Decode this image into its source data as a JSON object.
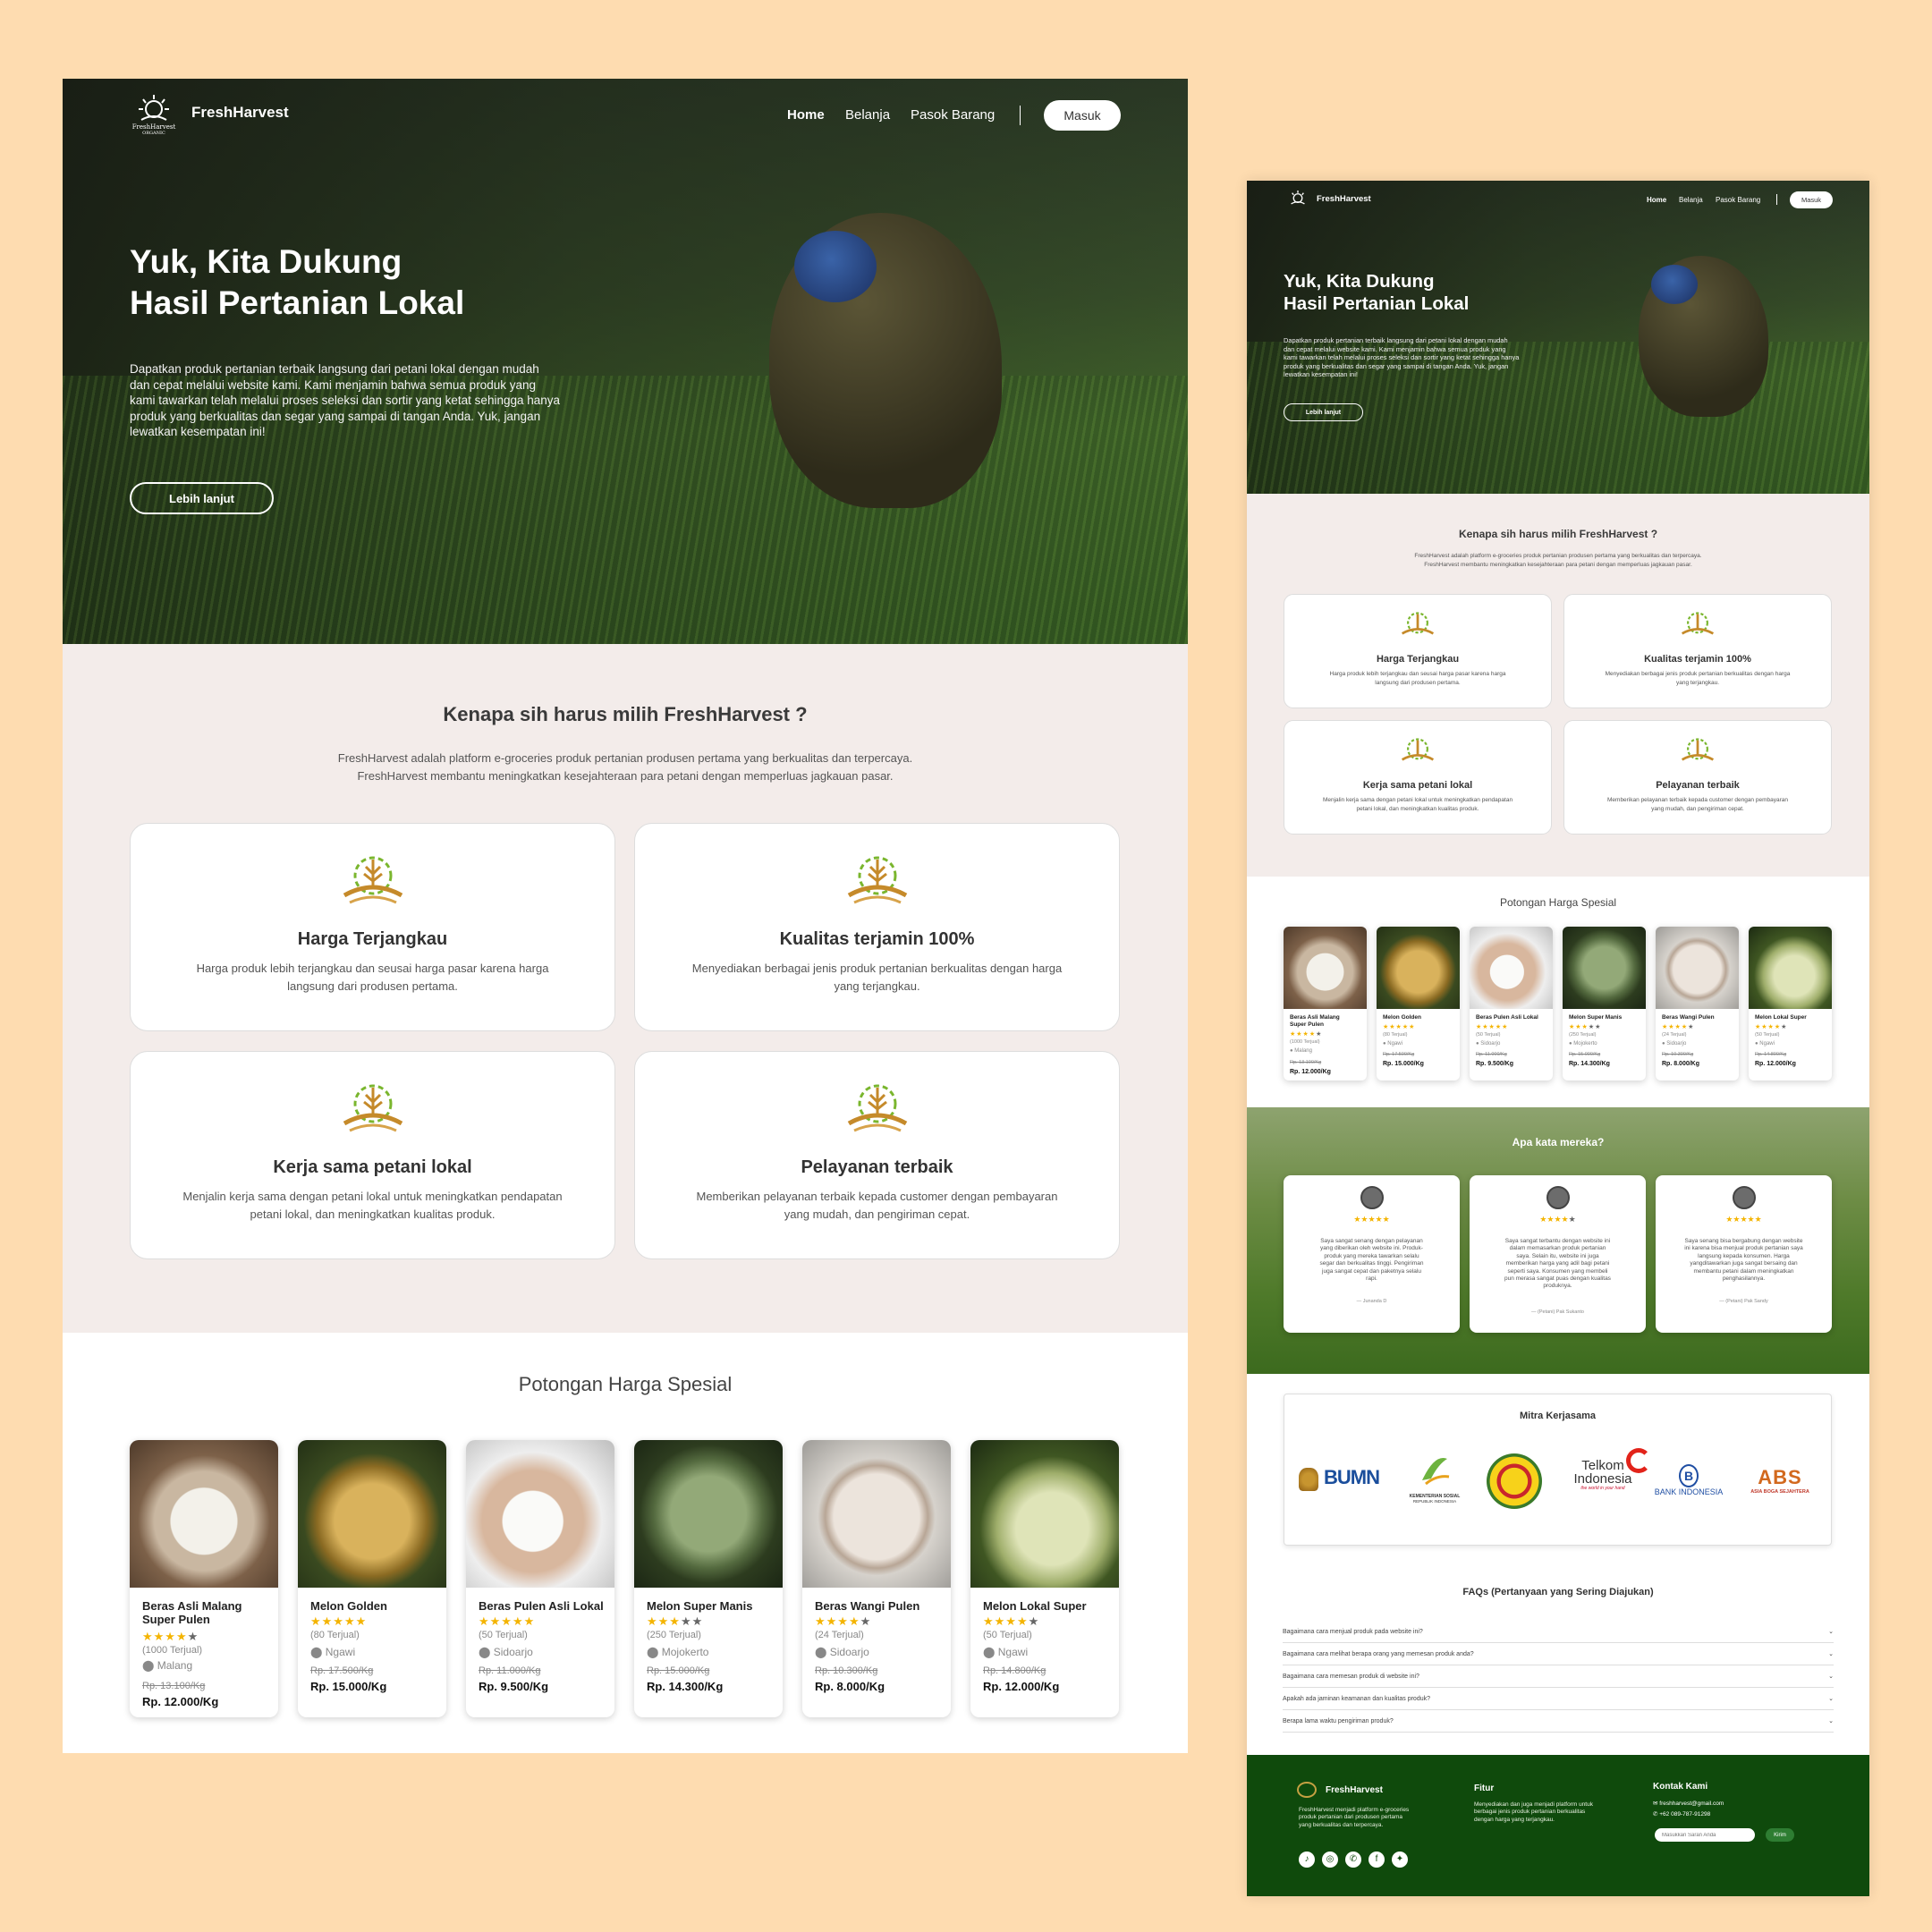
{
  "brand": {
    "name": "FreshHarvest",
    "logo_caption": "FreshHarvest",
    "logo_sub": "ORGANIC"
  },
  "nav": {
    "home": "Home",
    "belanja": "Belanja",
    "pasok": "Pasok Barang",
    "login": "Masuk"
  },
  "hero": {
    "title1": "Yuk, Kita Dukung",
    "title2": "Hasil Pertanian Lokal",
    "desc1": "Dapatkan produk pertanian terbaik langsung dari petani lokal dengan mudah",
    "desc2": "dan cepat melalui website kami. Kami menjamin bahwa semua produk yang",
    "desc3": "kami tawarkan telah melalui proses seleksi dan sortir yang ketat sehingga hanya",
    "desc4": "produk yang berkualitas dan segar yang sampai di tangan Anda. Yuk, jangan",
    "desc5": "lewatkan kesempatan ini!",
    "cta": "Lebih lanjut"
  },
  "why": {
    "title": "Kenapa sih harus milih FreshHarvest ?",
    "desc1": "FreshHarvest adalah platform e-groceries produk pertanian produsen pertama yang berkualitas dan terpercaya.",
    "desc2": "FreshHarvest membantu meningkatkan kesejahteraan para petani dengan memperluas jagkauan pasar.",
    "cards": [
      {
        "title": "Harga Terjangkau",
        "d1": "Harga produk lebih terjangkau dan seusai harga pasar karena harga",
        "d2": "langsung dari produsen pertama."
      },
      {
        "title": "Kualitas terjamin 100%",
        "d1": "Menyediakan berbagai jenis produk pertanian berkualitas dengan harga",
        "d2": "yang terjangkau."
      },
      {
        "title": "Kerja sama petani lokal",
        "d1": "Menjalin kerja sama dengan petani lokal untuk meningkatkan pendapatan",
        "d2": "petani lokal, dan meningkatkan kualitas produk."
      },
      {
        "title": "Pelayanan terbaik",
        "d1": "Memberikan pelayanan terbaik kepada customer dengan pembayaran",
        "d2": "yang mudah, dan pengiriman cepat."
      }
    ]
  },
  "deals": {
    "title": "Potongan Harga Spesial",
    "products": [
      {
        "name1": "Beras Asli Malang",
        "name2": "Super Pulen",
        "stars": "★★★★",
        "dim": "★",
        "sold": "(1000 Terjual)",
        "loc": "Malang",
        "old": "Rp. 13.100/Kg",
        "price": "Rp. 12.000/Kg"
      },
      {
        "name1": "Melon Golden",
        "name2": "",
        "stars": "★★★★★",
        "dim": "",
        "sold": "(80 Terjual)",
        "loc": "Ngawi",
        "old": "Rp. 17.500/Kg",
        "price": "Rp. 15.000/Kg"
      },
      {
        "name1": "Beras Pulen Asli Lokal",
        "name2": "",
        "stars": "★★★★★",
        "dim": "",
        "sold": "(50 Terjual)",
        "loc": "Sidoarjo",
        "old": "Rp. 11.000/Kg",
        "price": "Rp. 9.500/Kg"
      },
      {
        "name1": "Melon Super Manis",
        "name2": "",
        "stars": "★★★",
        "dim": "★★",
        "sold": "(250 Terjual)",
        "loc": "Mojokerto",
        "old": "Rp. 15.000/Kg",
        "price": "Rp. 14.300/Kg"
      },
      {
        "name1": "Beras Wangi Pulen",
        "name2": "",
        "stars": "★★★★",
        "dim": "★",
        "sold": "(24 Terjual)",
        "loc": "Sidoarjo",
        "old": "Rp. 10.300/Kg",
        "price": "Rp. 8.000/Kg"
      },
      {
        "name1": "Melon Lokal Super",
        "name2": "",
        "stars": "★★★★",
        "dim": "★",
        "sold": "(50 Terjual)",
        "loc": "Ngawi",
        "old": "Rp. 14.800/Kg",
        "price": "Rp. 12.000/Kg"
      }
    ]
  },
  "testimonials": {
    "title": "Apa kata mereka?",
    "items": [
      {
        "stars": "★★★★★",
        "dim": "",
        "l1": "Saya sangat senang dengan pelayanan",
        "l2": "yang diberikan oleh website ini. Produk-",
        "l3": "produk yang mereka tawarkan selalu",
        "l4": "segar dan berkualitas tinggi. Pengiriman",
        "l5": "juga sangat cepat dan paketnya selalu",
        "l6": "rapi.",
        "l7": "",
        "by": "— Junanda D"
      },
      {
        "stars": "★★★★",
        "dim": "★",
        "l1": "Saya sangat terbantu dengan website ini",
        "l2": "dalam memasarkan produk pertanian",
        "l3": "saya. Selain itu, website ini juga",
        "l4": "memberikan harga yang adil bagi petani",
        "l5": "seperti saya. Konsumen yang membeli",
        "l6": "pun merasa sangat puas dengan kualitas",
        "l7": "produknya.",
        "by": "— (Petani) Pak Sukanto"
      },
      {
        "stars": "★★★★★",
        "dim": "",
        "l1": "Saya senang bisa bergabung dengan website",
        "l2": "ini karena bisa menjual produk pertanian saya",
        "l3": "langsung kepada konsumen. Harga",
        "l4": "yangditawarkan juga sangat bersaing dan",
        "l5": "membantu petani dalam meningkatkan",
        "l6": "penghasilannya.",
        "l7": "",
        "by": "— (Petani) Pak Sandy"
      }
    ]
  },
  "mitra": {
    "title": "Mitra Kerjasama",
    "bumn": "BUMN",
    "kemensos1": "KEMENTERIAN SOSIAL",
    "kemensos2": "REPUBLIK INDONESIA",
    "telkom1": "Telkom",
    "telkom2": "Indonesia",
    "telkom3": "the world in your hand",
    "bi": "BANK INDONESIA",
    "abs1": "ABS",
    "abs2": "ASIA BOGA SEJAHTERA"
  },
  "faq": {
    "title": "FAQs (Pertanyaan yang Sering Diajukan)",
    "items": [
      "Bagaimana cara menjual produk pada website ini?",
      "Bagaimana cara melihat berapa orang yang memesan produk anda?",
      "Bagaimana cara memesan produk di website ini?",
      "Apakah ada jaminan keamanan dan kualitas produk?",
      "Berapa lama waktu pengiriman produk?"
    ]
  },
  "footer": {
    "brand": "FreshHarvest",
    "about1": "FreshHarvest menjadi platform e-groceries",
    "about2": "produk pertanian dari produsen pertama",
    "about3": "yang berkualitas dan terpercaya.",
    "fitur": "Fitur",
    "fitur1": "Menyediakan dan juga menjadi platform untuk",
    "fitur2": "berbagai jenis produk pertanian berkualitas",
    "fitur3": "dengan harga yang terjangkau.",
    "kontak": "Kontak Kami",
    "email": "freshharvest@gmail.com",
    "phone": "+62 089-787-91298",
    "placeholder": "Masukkan Saran Anda",
    "send": "Kirim"
  },
  "colors": {
    "bg": "#fedcb0",
    "footer": "#0f4a0c",
    "star": "#f4b400",
    "section": "#f3ecea"
  }
}
